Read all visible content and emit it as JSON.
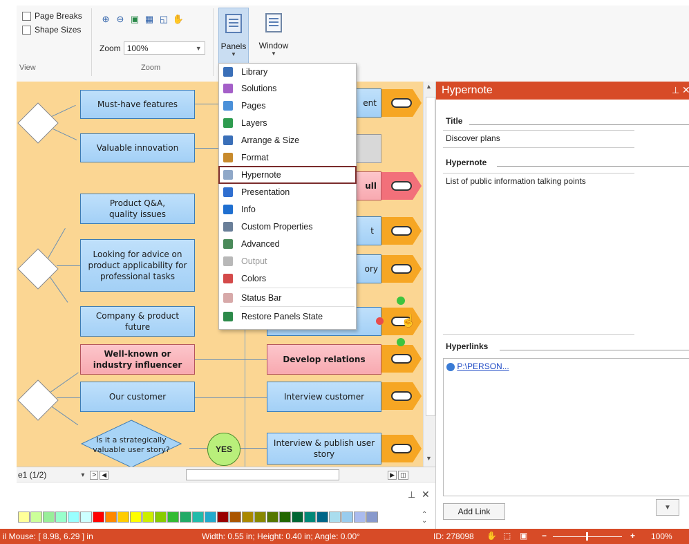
{
  "ribbon": {
    "view_group": {
      "page_breaks": "Page Breaks",
      "shape_sizes": "Shape Sizes",
      "label": "View"
    },
    "zoom_group": {
      "zoom_label": "Zoom",
      "zoom_value": "100%",
      "label": "Zoom"
    },
    "panels_button": "Panels",
    "window_button": "Window"
  },
  "menu": {
    "items": [
      {
        "label": "Library",
        "icon": "library-icon",
        "color": "#3a6fb8"
      },
      {
        "label": "Solutions",
        "icon": "solutions-icon",
        "color": "#a45fc8"
      },
      {
        "label": "Pages",
        "icon": "pages-icon",
        "color": "#4a90d9"
      },
      {
        "label": "Layers",
        "icon": "layers-icon",
        "color": "#2e9c4f"
      },
      {
        "label": "Arrange & Size",
        "icon": "arrange-icon",
        "color": "#3a6fb8"
      },
      {
        "label": "Format",
        "icon": "format-brush-icon",
        "color": "#c88a2c"
      },
      {
        "label": "Hypernote",
        "icon": "hypernote-icon",
        "color": "#8fa8c8"
      },
      {
        "label": "Presentation",
        "icon": "presentation-icon",
        "color": "#2f6fd0"
      },
      {
        "label": "Info",
        "icon": "info-icon",
        "color": "#1f6fd0"
      },
      {
        "label": "Custom Properties",
        "icon": "custom-properties-icon",
        "color": "#6a7f99"
      },
      {
        "label": "Advanced",
        "icon": "advanced-icon",
        "color": "#4a8a5a"
      },
      {
        "label": "Output",
        "icon": "output-icon",
        "color": "#b8b8b8"
      },
      {
        "label": "Colors",
        "icon": "colors-icon",
        "color": "#d44a4a"
      },
      {
        "label": "Status Bar",
        "icon": "status-bar-icon",
        "color": "#d7a9a9"
      },
      {
        "label": "Restore Panels State",
        "icon": "restore-icon",
        "color": "#2c8a4a"
      }
    ]
  },
  "diagram": {
    "nodes": {
      "must_have": "Must-have features",
      "valuable": "Valuable innovation",
      "qa": "Product Q&A, quality issues",
      "advice": "Looking for advice on product applicability for professional tasks",
      "company": "Company & product future",
      "influencer": "Well-known or industry influencer",
      "customer": "Our customer",
      "strategic": "Is it a strategically valuable user story?",
      "yes": "YES",
      "develop": "Develop relations",
      "interview": "Interview customer",
      "publish": "Interview & publish user story",
      "partial_1": "ent",
      "partial_2": "ull",
      "partial_3": "t",
      "partial_4": "ory"
    }
  },
  "pagebar": {
    "page": "e1 (1/2)"
  },
  "statusbar": {
    "mouse": "il  Mouse: [ 8.98, 6.29 ] in",
    "dims": "Width: 0.55 in;  Height: 0.40 in;  Angle: 0.00°",
    "id": "ID: 278098",
    "zoom": "100%"
  },
  "hypernote": {
    "header": "Hypernote",
    "title_label": "Title",
    "title_value": "Discover plans",
    "note_label": "Hypernote",
    "note_value": "List of public information talking points",
    "links_label": "Hyperlinks",
    "link_value": "P:\\PERSON...",
    "add_link": "Add Link"
  },
  "palette": [
    "#ffff99",
    "#ccff99",
    "#99ee99",
    "#99ffcc",
    "#99ffff",
    "#ccffff",
    "#ff0000",
    "#ff8800",
    "#ffcc00",
    "#ffff00",
    "#ccee00",
    "#88cc00",
    "#33bb33",
    "#22aa66",
    "#22bbaa",
    "#22aacc",
    "#990000",
    "#aa5500",
    "#aa8800",
    "#888800",
    "#557700",
    "#226600",
    "#006633",
    "#008877",
    "#006688",
    "#aaddee",
    "#99ccee",
    "#aabbee",
    "#8899cc"
  ]
}
